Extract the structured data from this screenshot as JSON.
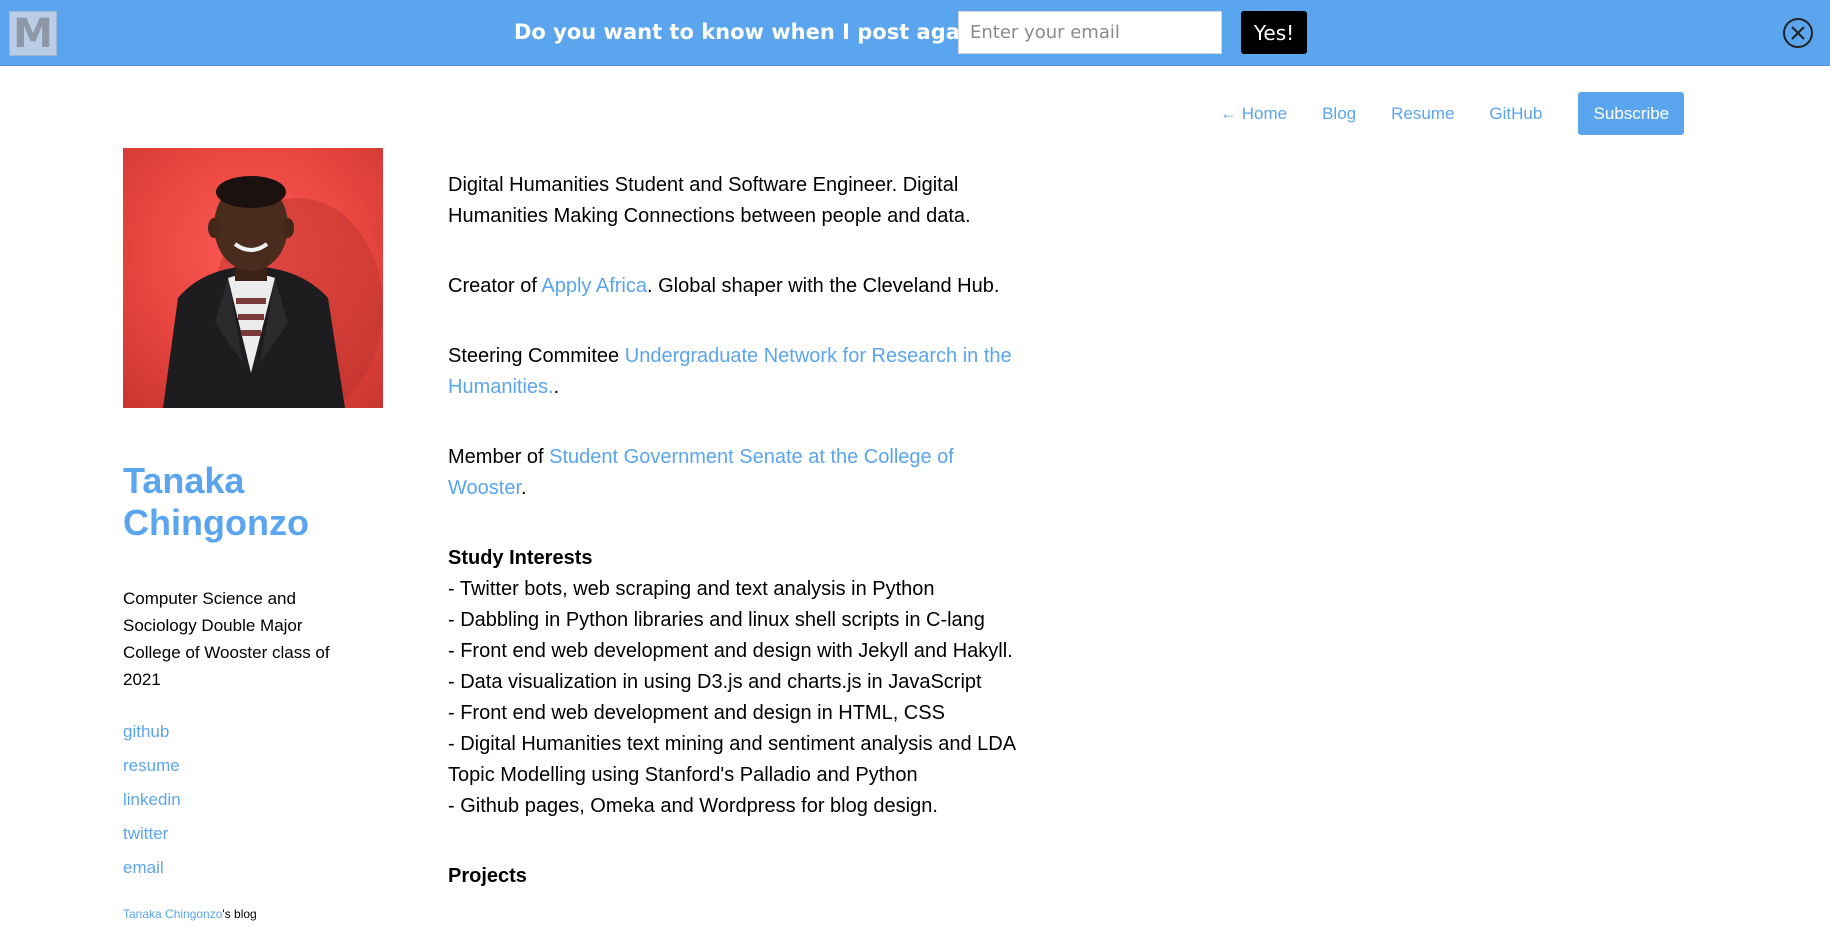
{
  "banner": {
    "logo_letter": "M",
    "question": "Do you want to know when I post again?",
    "email_placeholder": "Enter your email",
    "email_value": "",
    "yes_label": "Yes!",
    "background_color": "#5aa5ee"
  },
  "nav": {
    "home": "← Home",
    "blog": "Blog",
    "resume": "Resume",
    "github": "GitHub",
    "subscribe": "Subscribe"
  },
  "sidebar": {
    "name": "Tanaka Chingonzo",
    "bio": "Computer Science and Sociology Double Major College of Wooster class of 2021",
    "links": [
      "github",
      "resume",
      "linkedin",
      "twitter",
      "email"
    ],
    "footer_name": "Tanaka Chingonzo",
    "footer_suffix": "'s blog"
  },
  "content": {
    "intro": "Digital Humanities Student and Software Engineer. Digital Humanities Making Connections between people and data.",
    "creator_prefix": "Creator of ",
    "creator_link": "Apply Africa",
    "creator_suffix": ". Global shaper with the Cleveland Hub.",
    "steering_prefix": "Steering Commitee ",
    "steering_link": "Undergraduate Network for Research in the Humanities.",
    "steering_suffix": ".",
    "member_prefix": "Member of ",
    "member_link": "Student Government Senate at the College of Wooster",
    "member_suffix": ".",
    "study_title": "Study Interests",
    "study_items": [
      "- Twitter bots, web scraping and text analysis in Python",
      "- Dabbling in Python libraries and linux shell scripts in C-lang",
      "- Front end web development and design with Jekyll and Hakyll.",
      "- Data visualization in using D3.js and charts.js in JavaScript",
      "- Front end web development and design in HTML, CSS",
      "- Digital Humanities text mining and sentiment analysis and LDA Topic Modelling using Stanford's Palladio and Python",
      "- Github pages, Omeka and Wordpress for blog design."
    ],
    "projects_title": "Projects"
  },
  "colors": {
    "accent": "#5aa5ee",
    "button_dark": "#000000"
  }
}
